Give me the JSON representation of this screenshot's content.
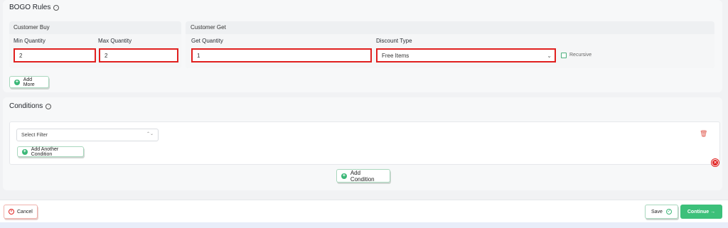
{
  "bogo": {
    "title": "BOGO Rules",
    "customer_buy": {
      "heading": "Customer Buy",
      "min_label": "Min Quantity",
      "min_value": "2",
      "max_label": "Max Quantity",
      "max_value": "2"
    },
    "customer_get": {
      "heading": "Customer Get",
      "get_label": "Get Quantity",
      "get_value": "1",
      "discount_label": "Discount Type",
      "discount_value": "Free Items",
      "recursive_label": "Recursive"
    },
    "add_more_label": "Add More"
  },
  "conditions": {
    "title": "Conditions",
    "select_filter_label": "Select Filter",
    "add_another_label": "Add Another Condition",
    "add_condition_label": "Add Condition"
  },
  "footer": {
    "cancel_label": "Cancel",
    "save_label": "Save",
    "continue_label": "Continue →"
  },
  "colors": {
    "accent_green": "#3cc07a",
    "error_red": "#e0201f"
  },
  "icons": {
    "info": "info-icon",
    "plus": "plus-circle-icon",
    "trash": "trash-icon",
    "close": "close-icon",
    "check": "check-icon"
  }
}
